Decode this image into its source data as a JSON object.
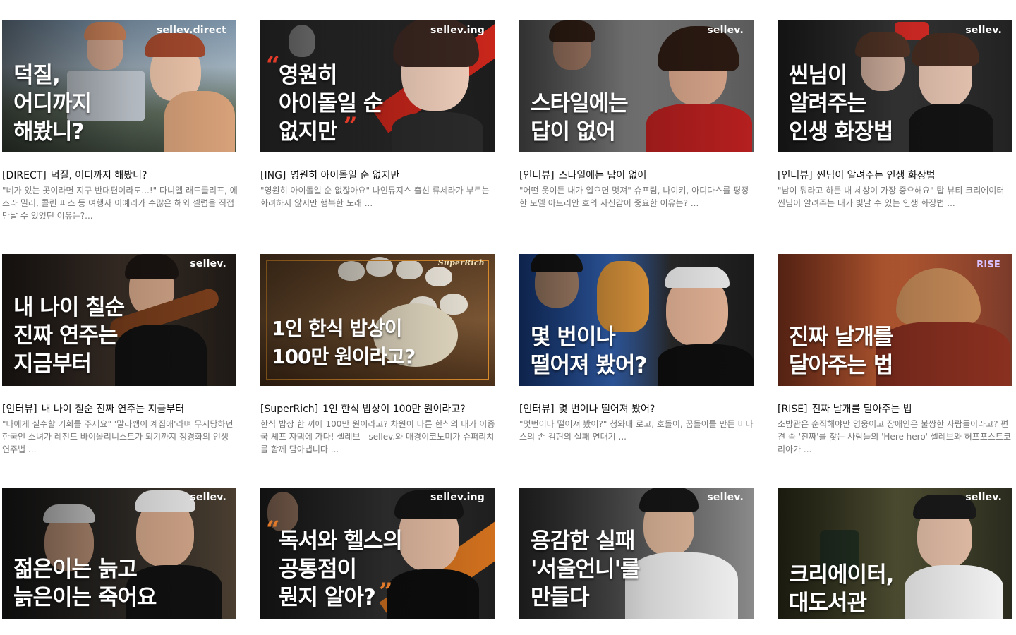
{
  "cards": [
    {
      "logo": "sellev.direct",
      "headline": "덕질,\n어디까지\n해봤니?",
      "tag": "[DIRECT]",
      "title": "덕질, 어디까지 해봤니?",
      "desc": "\"네가 있는 곳이라면 지구 반대편이라도...!\" 다니엘 래드클리프, 에즈라 밀러, 콜린 퍼스 등 여행자 이예리가 수많은 해외 셀럽을 직접 만날 수 있었던 이유는?..."
    },
    {
      "logo": "sellev.ing",
      "headline": "영원히\n아이돌일 순\n없지만",
      "tag": "[ING]",
      "title": "영원히 아이돌일 순 없지만",
      "desc": "\"영원히 아이돌일 순 없잖아요\" 나인뮤지스 출신 류세라가 부르는 화려하지 않지만 행복한 노래 ..."
    },
    {
      "logo": "sellev.",
      "headline": "스타일에는\n답이 없어",
      "tag": "[인터뷰]",
      "title": "스타일에는 답이 없어",
      "desc": "\"어떤 옷이든 내가 입으면 멋져\" 슈프림, 나이키, 아디다스를 평정한 모델 아드리안 호의 자신감이 중요한 이유는? ..."
    },
    {
      "logo": "sellev.",
      "headline": "씬님이\n알려주는\n인생 화장법",
      "tag": "[인터뷰]",
      "title": "씬님이 알려주는 인생 화장법",
      "desc": "\"남이 뭐라고 하든 내 세상이 가장 중요해요\" 탑 뷰티 크리에이터 씬님이 알려주는 내가 빛날 수 있는 인생 화장법 ..."
    },
    {
      "logo": "sellev.",
      "headline": "내 나이 칠순\n진짜 연주는\n지금부터",
      "tag": "[인터뷰]",
      "title": "내 나이 칠순 진짜 연주는 지금부터",
      "desc": "\"나에게 실수할 기회를 주세요\" '말라깽이 계집애'라며 무시당하던 한국인 소녀가 레전드 바이올리니스트가 되기까지 정경화의 인생 연주법 ..."
    },
    {
      "logo": "SuperRich",
      "headline": "1인 한식 밥상이\n100만 원이라고?",
      "tag": "[SuperRich]",
      "title": "1인 한식 밥상이 100만 원이라고?",
      "desc": "한식 밥상 한 끼에 100만 원이라고? 차원이 다른 한식의 대가 이종국 셰프 자택에 가다! 셀레브 - sellev.와 매경이코노미가 슈퍼리치를 함께 담아냅니다 ..."
    },
    {
      "logo": "",
      "headline": "몇 번이나\n떨어져 봤어?",
      "tag": "[인터뷰]",
      "title": "몇 번이나 떨어져 봤어?",
      "desc": "\"몇번이나 떨어져 봤어?\" 청와대 로고, 호돌이, 꿈돌이를 만든 미다스의 손 김현의 실패 연대기 ..."
    },
    {
      "logo": "RISE",
      "headline": "진짜 날개를\n달아주는 법",
      "tag": "[RISE]",
      "title": "진짜 날개를 달아주는 법",
      "desc": "소방관은 순직해야만 영웅이고 장애인은 불쌍한 사람들이라고? 편견 속 '진짜'를 찾는 사람들의 'Here hero' 셀레브와 허프포스트코리아가 ..."
    },
    {
      "logo": "sellev.",
      "headline": "젊은이는 늙고\n늙은이는 죽어요",
      "tag": "",
      "title": "",
      "desc": ""
    },
    {
      "logo": "sellev.ing",
      "headline": "독서와 헬스의\n공통점이\n뭔지 알아?",
      "tag": "",
      "title": "",
      "desc": ""
    },
    {
      "logo": "sellev.",
      "headline": "용감한 실패\n'서울언니'를\n만들다",
      "tag": "",
      "title": "",
      "desc": ""
    },
    {
      "logo": "sellev.",
      "headline": "크리에이터,\n대도서관",
      "tag": "",
      "title": "",
      "desc": ""
    }
  ]
}
